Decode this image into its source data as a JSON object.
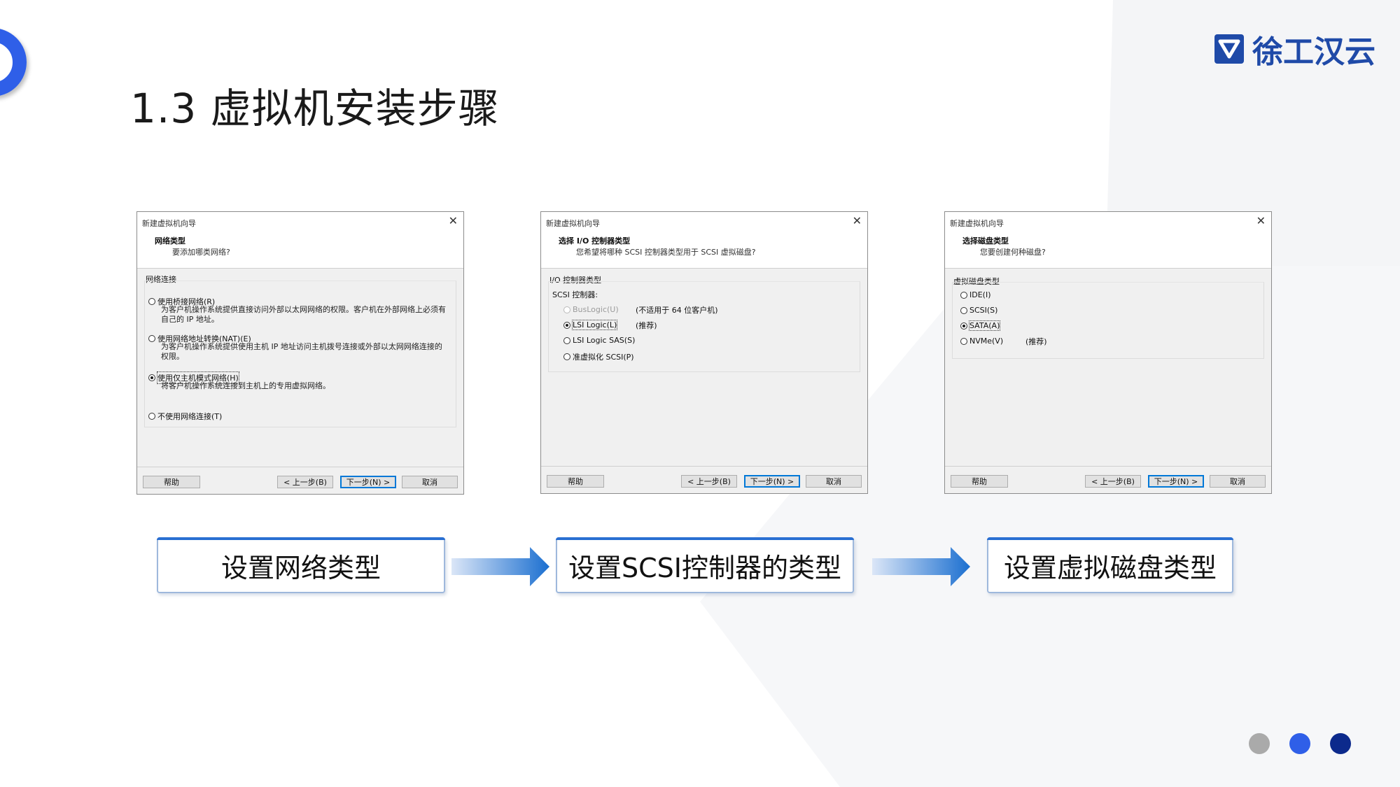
{
  "slide": {
    "title": "1.3 虚拟机安装步骤",
    "logo_text": "徐工汉云",
    "colors": {
      "brand_blue": "#1f4aa8",
      "accent_blue": "#2f5fe8",
      "dark_blue": "#0c2a8c",
      "dot_gray": "#aaaaaa"
    }
  },
  "dialogs": [
    {
      "window_title": "新建虚拟机向导",
      "heading": "网络类型",
      "subheading": "要添加哪类网络?",
      "group_label": "网络连接",
      "options": [
        {
          "label": "使用桥接网络(R)",
          "checked": false,
          "description": "为客户机操作系统提供直接访问外部以太网网络的权限。客户机在外部网络上必须有自己的 IP 地址。"
        },
        {
          "label": "使用网络地址转换(NAT)(E)",
          "checked": false,
          "description": "为客户机操作系统提供使用主机 IP 地址访问主机拨号连接或外部以太网网络连接的权限。"
        },
        {
          "label": "使用仅主机模式网络(H)",
          "checked": true,
          "description": "将客户机操作系统连接到主机上的专用虚拟网络。"
        },
        {
          "label": "不使用网络连接(T)",
          "checked": false,
          "description": ""
        }
      ],
      "buttons": {
        "help": "帮助",
        "back": "< 上一步(B)",
        "next": "下一步(N) >",
        "cancel": "取消"
      }
    },
    {
      "window_title": "新建虚拟机向导",
      "heading": "选择 I/O 控制器类型",
      "subheading": "您希望将哪种 SCSI 控制器类型用于 SCSI 虚拟磁盘?",
      "group_label": "I/O 控制器类型",
      "sub_label": "SCSI 控制器:",
      "options": [
        {
          "label": "BusLogic(U)",
          "checked": false,
          "disabled": true,
          "note": "(不适用于 64 位客户机)"
        },
        {
          "label": "LSI Logic(L)",
          "checked": true,
          "note": "(推荐)"
        },
        {
          "label": "LSI Logic SAS(S)",
          "checked": false,
          "note": ""
        },
        {
          "label": "准虚拟化 SCSI(P)",
          "checked": false,
          "note": ""
        }
      ],
      "buttons": {
        "help": "帮助",
        "back": "< 上一步(B)",
        "next": "下一步(N) >",
        "cancel": "取消"
      }
    },
    {
      "window_title": "新建虚拟机向导",
      "heading": "选择磁盘类型",
      "subheading": "您要创建何种磁盘?",
      "group_label": "虚拟磁盘类型",
      "options": [
        {
          "label": "IDE(I)",
          "checked": false,
          "note": ""
        },
        {
          "label": "SCSI(S)",
          "checked": false,
          "note": ""
        },
        {
          "label": "SATA(A)",
          "checked": true,
          "note": ""
        },
        {
          "label": "NVMe(V)",
          "checked": false,
          "note": "(推荐)"
        }
      ],
      "buttons": {
        "help": "帮助",
        "back": "< 上一步(B)",
        "next": "下一步(N) >",
        "cancel": "取消"
      }
    }
  ],
  "steps": [
    {
      "label": "设置网络类型"
    },
    {
      "label": "设置SCSI控制器的类型"
    },
    {
      "label": "设置虚拟磁盘类型"
    }
  ]
}
